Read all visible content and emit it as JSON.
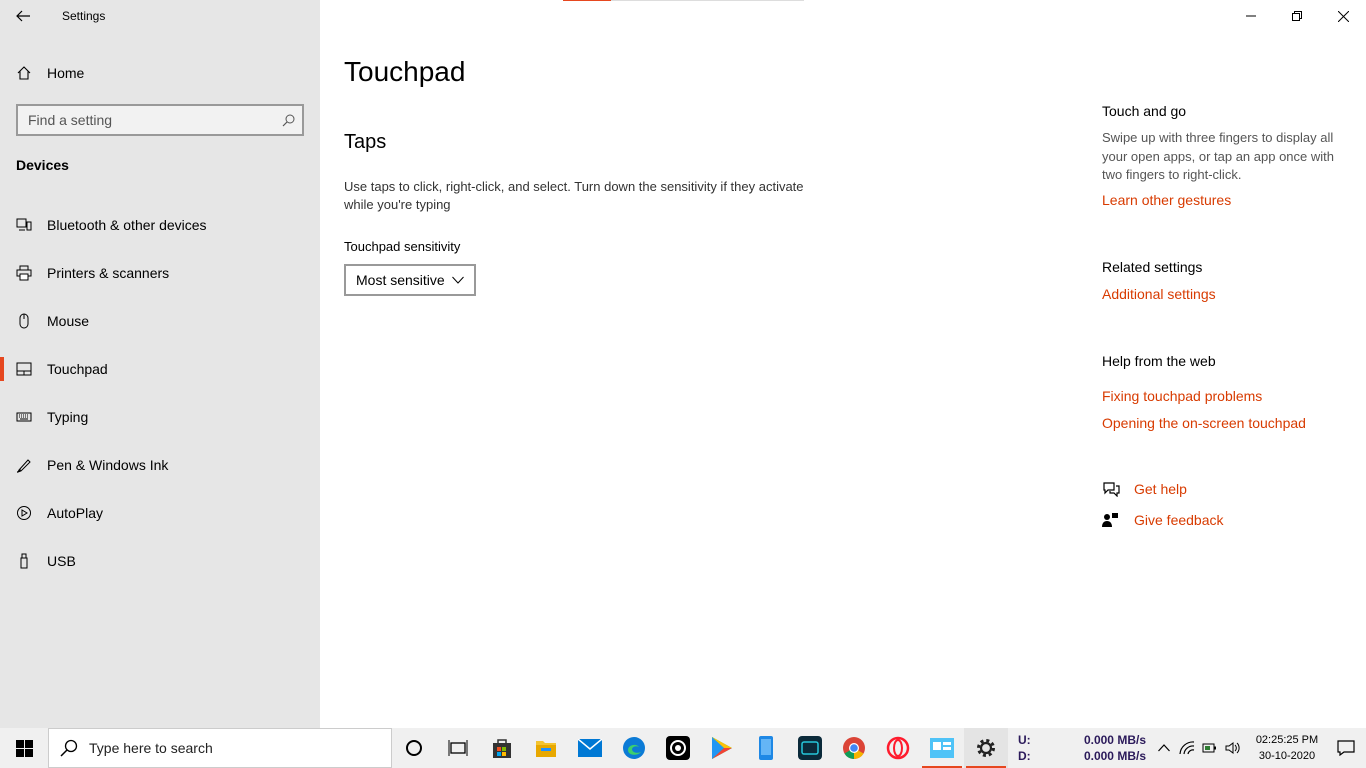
{
  "window": {
    "title": "Settings",
    "controls": {
      "minimize": "—",
      "restore": "❐",
      "close": "✕"
    }
  },
  "sidebar": {
    "home": "Home",
    "search_placeholder": "Find a setting",
    "section": "Devices",
    "items": [
      {
        "label": "Bluetooth & other devices",
        "icon": "bluetooth-devices-icon"
      },
      {
        "label": "Printers & scanners",
        "icon": "printer-icon"
      },
      {
        "label": "Mouse",
        "icon": "mouse-icon"
      },
      {
        "label": "Touchpad",
        "icon": "touchpad-icon",
        "active": true
      },
      {
        "label": "Typing",
        "icon": "keyboard-icon"
      },
      {
        "label": "Pen & Windows Ink",
        "icon": "pen-icon"
      },
      {
        "label": "AutoPlay",
        "icon": "autoplay-icon"
      },
      {
        "label": "USB",
        "icon": "usb-icon"
      }
    ]
  },
  "main": {
    "title": "Touchpad",
    "taps_heading": "Taps",
    "taps_description": "Use taps to click, right-click, and select. Turn down the sensitivity if they activate while you're typing",
    "sensitivity_label": "Touchpad sensitivity",
    "sensitivity_value": "Most sensitive"
  },
  "right": {
    "touch_heading": "Touch and go",
    "touch_text": "Swipe up with three fingers to display all your open apps, or tap an app once with two fingers to right-click.",
    "learn_link": "Learn other gestures",
    "related_heading": "Related settings",
    "additional_link": "Additional settings",
    "help_heading": "Help from the web",
    "help_link1": "Fixing touchpad problems",
    "help_link2": "Opening the on-screen touchpad",
    "get_help": "Get help",
    "give_feedback": "Give feedback"
  },
  "taskbar": {
    "search_placeholder": "Type here to search",
    "net_upload_label": "U:",
    "net_upload_value": "0.000 MB/s",
    "net_download_label": "D:",
    "net_download_value": "0.000 MB/s",
    "time": "02:25:25 PM",
    "date": "30-10-2020"
  },
  "colors": {
    "accent": "#e6471f",
    "link": "#d83b01",
    "sidebar_bg": "#e6e6e6"
  }
}
